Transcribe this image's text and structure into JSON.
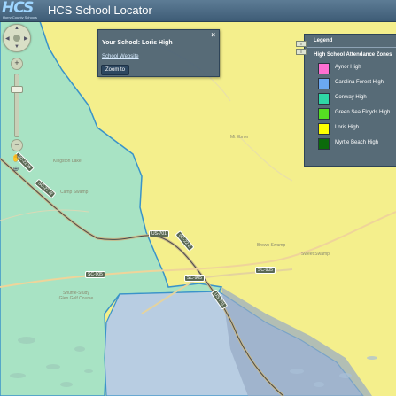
{
  "header": {
    "logo_text": "HCS",
    "logo_subtext": "Horry County Schools",
    "title": "HCS School Locator"
  },
  "popup": {
    "title": "Your School: Loris High",
    "close_label": "×",
    "website_link": "School Website",
    "zoom_button": "Zoom to"
  },
  "legend": {
    "title": "Legend",
    "layer_title": "High School Attendance Zones",
    "items": [
      {
        "label": "Aynor High",
        "color": "#ff6fd2"
      },
      {
        "label": "Carolina Forest High",
        "color": "#6ba8f2"
      },
      {
        "label": "Conway High",
        "color": "#2fd8a6"
      },
      {
        "label": "Green Sea Floyds High",
        "color": "#55dd22"
      },
      {
        "label": "Loris High",
        "color": "#ffff00"
      },
      {
        "label": "Myrtle Beach High",
        "color": "#0b6b0b"
      }
    ]
  },
  "map": {
    "road_labels": [
      "SC-22 W",
      "SC-22 W",
      "US-701",
      "US-701",
      "SC-905",
      "SC-905",
      "SC-905",
      "SC-22 E"
    ],
    "place_labels": [
      "Mt Ebron",
      "Shuffle-Study Glen Golf Course",
      "Camp Swamp",
      "Kingston Lake",
      "Sweet Swamp",
      "Brown Swamp"
    ],
    "zone_colors": {
      "loris": "#f5f08c",
      "conway": "#a9e6c6",
      "carolina_forest": "#b7cde3"
    }
  },
  "nav": {
    "zoom_in": "+",
    "zoom_out": "−"
  }
}
